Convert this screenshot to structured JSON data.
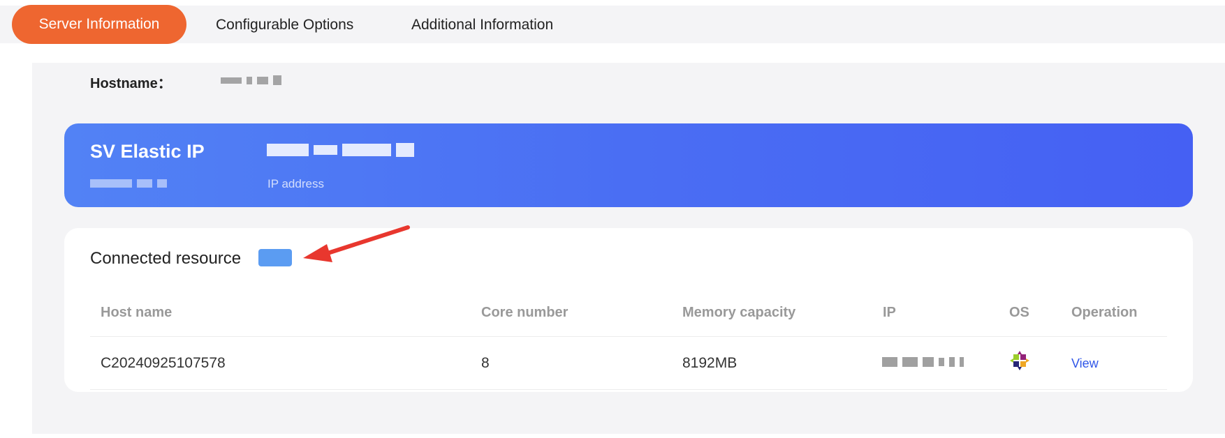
{
  "tabs": [
    {
      "label": "Server Information",
      "active": true
    },
    {
      "label": "Configurable Options",
      "active": false
    },
    {
      "label": "Additional Information",
      "active": false
    }
  ],
  "server": {
    "hostname_label": "Hostname："
  },
  "elastic_ip": {
    "title": "SV Elastic IP",
    "caption": "IP address"
  },
  "connected": {
    "title": "Connected resource",
    "columns": [
      "Host name",
      "Core number",
      "Memory capacity",
      "IP",
      "OS",
      "Operation"
    ],
    "rows": [
      {
        "host_name": "C20240925107578",
        "core_number": "8",
        "memory": "8192MB",
        "operation": "View"
      }
    ]
  },
  "colors": {
    "accent_tab": "#ee6630",
    "ip_card": "#4a6ef3",
    "badge": "#5b9cf2",
    "link": "#3056e8",
    "arrow": "#e8372e"
  },
  "icons": {
    "os": "centos-logo-icon",
    "annotation": "red-arrow-icon"
  }
}
